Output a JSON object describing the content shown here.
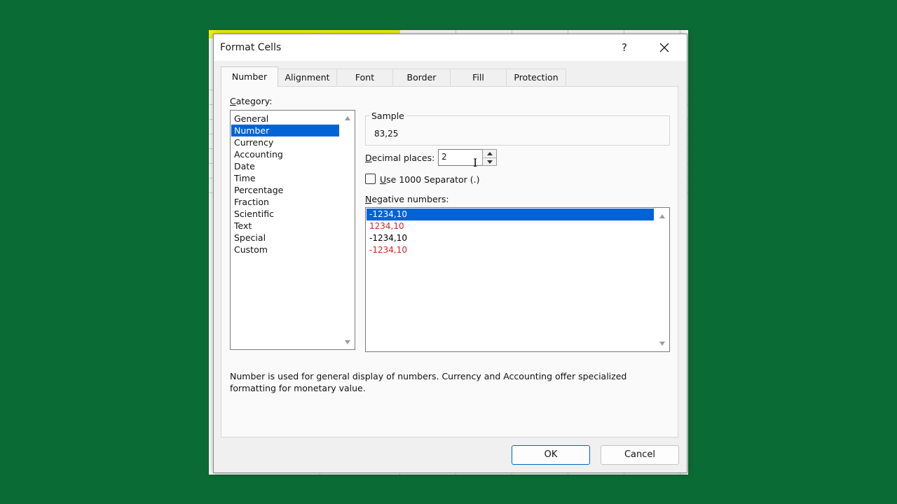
{
  "dialog": {
    "title": "Format Cells",
    "help_label": "?",
    "close_label": "✕"
  },
  "tabs": [
    {
      "label": "Number",
      "active": true
    },
    {
      "label": "Alignment",
      "active": false
    },
    {
      "label": "Font",
      "active": false
    },
    {
      "label": "Border",
      "active": false
    },
    {
      "label": "Fill",
      "active": false
    },
    {
      "label": "Protection",
      "active": false
    }
  ],
  "category": {
    "label_mnemonic": "C",
    "label_rest": "ategory:",
    "items": [
      "General",
      "Number",
      "Currency",
      "Accounting",
      "Date",
      "Time",
      "Percentage",
      "Fraction",
      "Scientific",
      "Text",
      "Special",
      "Custom"
    ],
    "selected": "Number"
  },
  "sample": {
    "title": "Sample",
    "value": "83,25"
  },
  "decimal_places": {
    "label_mnemonic": "D",
    "label_rest": "ecimal places:",
    "value": "2"
  },
  "separator": {
    "label_mnemonic": "U",
    "label_rest": "se 1000 Separator (.)",
    "checked": false
  },
  "negative_numbers": {
    "label_mnemonic": "N",
    "label_rest": "egative numbers:",
    "items": [
      {
        "text": "-1234,10",
        "color": "#000000",
        "selected": true
      },
      {
        "text": "1234,10",
        "color": "#e02020",
        "selected": false
      },
      {
        "text": "-1234,10",
        "color": "#000000",
        "selected": false
      },
      {
        "text": "-1234,10",
        "color": "#e02020",
        "selected": false
      }
    ]
  },
  "description": "Number is used for general display of numbers.  Currency and Accounting offer specialized formatting for monetary value.",
  "buttons": {
    "ok": "OK",
    "cancel": "Cancel"
  },
  "colors": {
    "selection": "#0063d6",
    "background": "#0b6b34",
    "negative_red": "#e02020"
  }
}
